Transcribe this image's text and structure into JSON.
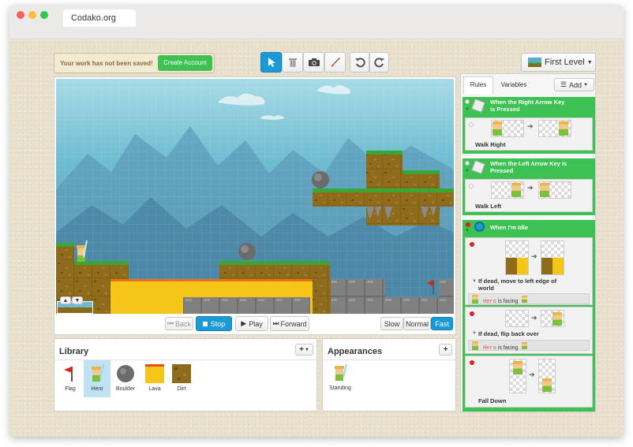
{
  "browser": {
    "tab_title": "Codako.org"
  },
  "toolbar": {
    "unsaved_message": "Your work has not been saved!",
    "create_account_label": "Create Account",
    "level_name": "First Level"
  },
  "stage": {
    "controls": {
      "back_label": "Back",
      "stop_label": "Stop",
      "play_label": "Play",
      "forward_label": "Forward",
      "speed_options": [
        "Slow",
        "Normal",
        "Fast"
      ],
      "selected_speed": "Fast"
    }
  },
  "library": {
    "title": "Library",
    "items": [
      {
        "name": "Flag",
        "icon": "flag-icon"
      },
      {
        "name": "Hero",
        "icon": "hero-icon",
        "selected": true
      },
      {
        "name": "Boulder",
        "icon": "boulder-icon"
      },
      {
        "name": "Lava",
        "icon": "lava-icon"
      },
      {
        "name": "Dirt",
        "icon": "dirt-icon"
      }
    ]
  },
  "appearances": {
    "title": "Appearances",
    "items": [
      {
        "name": "Standing"
      }
    ]
  },
  "rules_panel": {
    "tabs": [
      "Rules",
      "Variables"
    ],
    "active_tab": "Rules",
    "add_label": "Add",
    "groups": [
      {
        "title": "When the Right Arrow Key is Pressed",
        "rules": [
          {
            "name": "Walk Right"
          }
        ]
      },
      {
        "title": "When the Left Arrow Key is Pressed",
        "rules": [
          {
            "name": "Walk Left"
          }
        ]
      },
      {
        "title": "When I'm Idle",
        "rules": [
          {
            "name": "If dead, move to left edge of world",
            "condition": {
              "variable": "Hero",
              "text": "is facing"
            }
          },
          {
            "name": "If dead, flip back over",
            "condition": {
              "variable": "Hero",
              "text": "is facing"
            }
          },
          {
            "name": "Fall Down"
          }
        ]
      }
    ]
  },
  "colors": {
    "accent_green": "#3cc152",
    "accent_blue": "#1c9ad6",
    "lava": "#f5c518",
    "dirt": "#8a6a1a",
    "grass": "#3aa635"
  }
}
